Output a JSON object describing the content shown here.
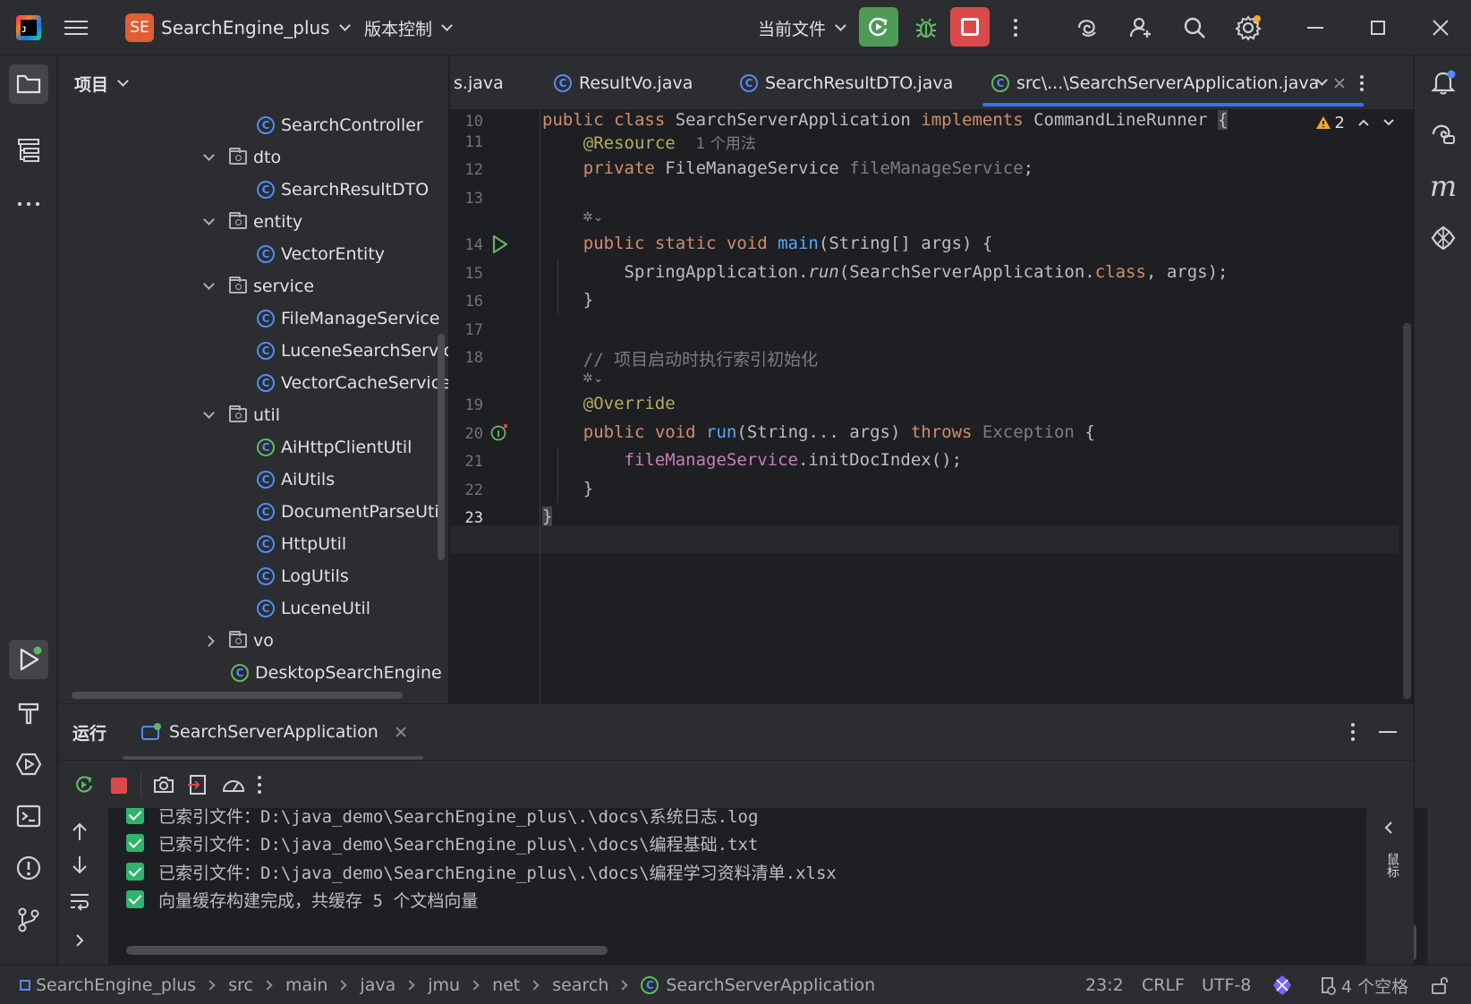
{
  "titlebar": {
    "project_badge": "SE",
    "project_name": "SearchEngine_plus",
    "vcs_label": "版本控制",
    "run_config_label": "当前文件"
  },
  "project_panel": {
    "title": "项目",
    "tree": [
      {
        "label": "SearchController",
        "kind": "class"
      },
      {
        "label": "dto",
        "kind": "folder"
      },
      {
        "label": "SearchResultDTO",
        "kind": "class"
      },
      {
        "label": "entity",
        "kind": "folder"
      },
      {
        "label": "VectorEntity",
        "kind": "class"
      },
      {
        "label": "service",
        "kind": "folder"
      },
      {
        "label": "FileManageService",
        "kind": "class"
      },
      {
        "label": "LuceneSearchService",
        "kind": "class"
      },
      {
        "label": "VectorCacheService",
        "kind": "class"
      },
      {
        "label": "util",
        "kind": "folder"
      },
      {
        "label": "AiHttpClientUtil",
        "kind": "class"
      },
      {
        "label": "AiUtils",
        "kind": "class"
      },
      {
        "label": "DocumentParseUtil",
        "kind": "class"
      },
      {
        "label": "HttpUtil",
        "kind": "class"
      },
      {
        "label": "LogUtils",
        "kind": "class"
      },
      {
        "label": "LuceneUtil",
        "kind": "class"
      },
      {
        "label": "vo",
        "kind": "folder-collapsed"
      },
      {
        "label": "DesktopSearchEngine",
        "kind": "class-app"
      }
    ]
  },
  "editor_tabs": [
    {
      "label": "s.java",
      "active": false
    },
    {
      "label": "ResultVo.java",
      "active": false
    },
    {
      "label": "SearchResultDTO.java",
      "active": false
    },
    {
      "label": "src\\...\\SearchServerApplication.java",
      "active": true
    }
  ],
  "editor": {
    "warning_count": "2",
    "usage_hint": "1 个用法",
    "line_numbers": [
      "10",
      "11",
      "12",
      "13",
      "14",
      "15",
      "16",
      "17",
      "18",
      "19",
      "20",
      "21",
      "22",
      "23"
    ]
  },
  "run_panel": {
    "title": "运行",
    "tab_label": "SearchServerApplication",
    "console_lines": [
      "已索引文件：D:\\java_demo\\SearchEngine_plus\\.\\docs\\系统日志.log",
      "已索引文件：D:\\java_demo\\SearchEngine_plus\\.\\docs\\编程基础.txt",
      "已索引文件：D:\\java_demo\\SearchEngine_plus\\.\\docs\\编程学习资料清单.xlsx",
      "向量缓存构建完成，共缓存 5 个文档向量"
    ],
    "right_label": "鼠标"
  },
  "statusbar": {
    "breadcrumbs": [
      "SearchEngine_plus",
      "src",
      "main",
      "java",
      "jmu",
      "net",
      "search",
      "SearchServerApplication"
    ],
    "position": "23:2",
    "line_sep": "CRLF",
    "encoding": "UTF-8",
    "indent": "4 个空格"
  },
  "colors": {
    "accent": "#3574f0",
    "run_green": "#4e9a57",
    "stop_red": "#db4a4a",
    "keyword": "#cf8e6d",
    "function": "#56a8f5",
    "field": "#c77dbb",
    "annotation": "#b3ae60"
  }
}
